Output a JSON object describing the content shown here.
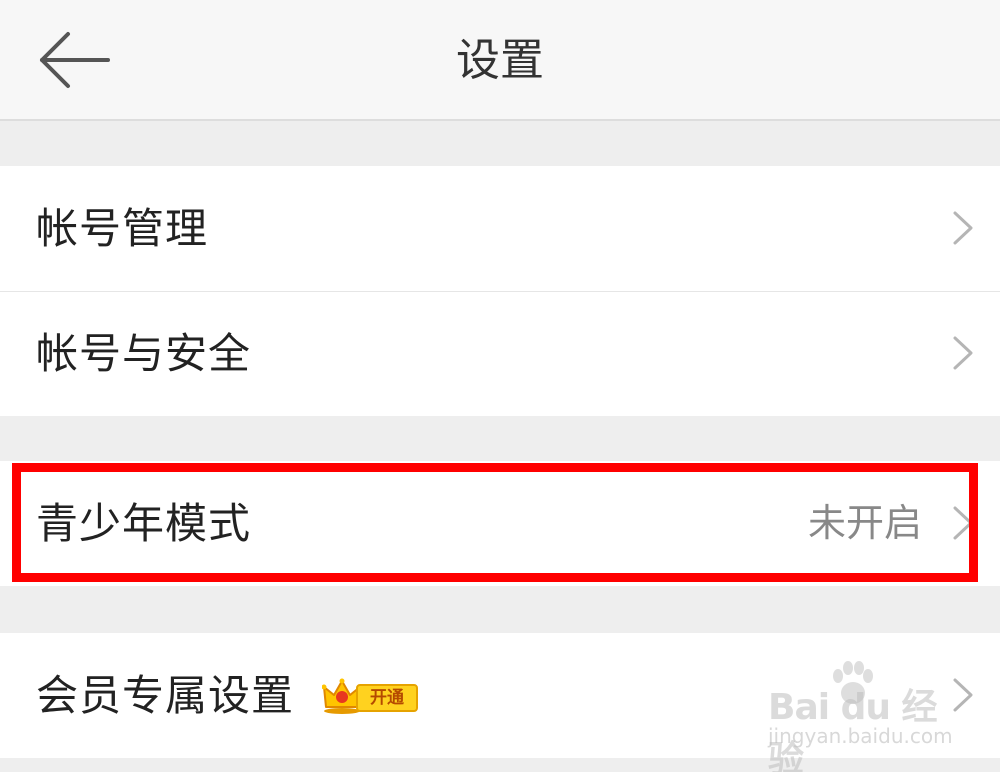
{
  "header": {
    "title": "设置",
    "back_icon": "arrow-left-icon"
  },
  "groups": [
    {
      "items": [
        {
          "label": "帐号管理",
          "chevron_icon": "chevron-right-icon"
        },
        {
          "label": "帐号与安全",
          "chevron_icon": "chevron-right-icon"
        }
      ]
    },
    {
      "items": [
        {
          "label": "青少年模式",
          "value": "未开启",
          "chevron_icon": "chevron-right-icon",
          "highlighted": true
        }
      ]
    },
    {
      "items": [
        {
          "label": "会员专属设置",
          "badge": {
            "icon": "crown-icon",
            "text": "开通"
          },
          "chevron_icon": "chevron-right-icon"
        }
      ]
    }
  ],
  "watermark": {
    "main": "Bai du 经验",
    "sub": "jingyan.baidu.com"
  },
  "colors": {
    "highlight": "#ff0000",
    "badge_bg": "#ffd21f",
    "badge_text": "#b54a00",
    "secondary_text": "#888888"
  }
}
